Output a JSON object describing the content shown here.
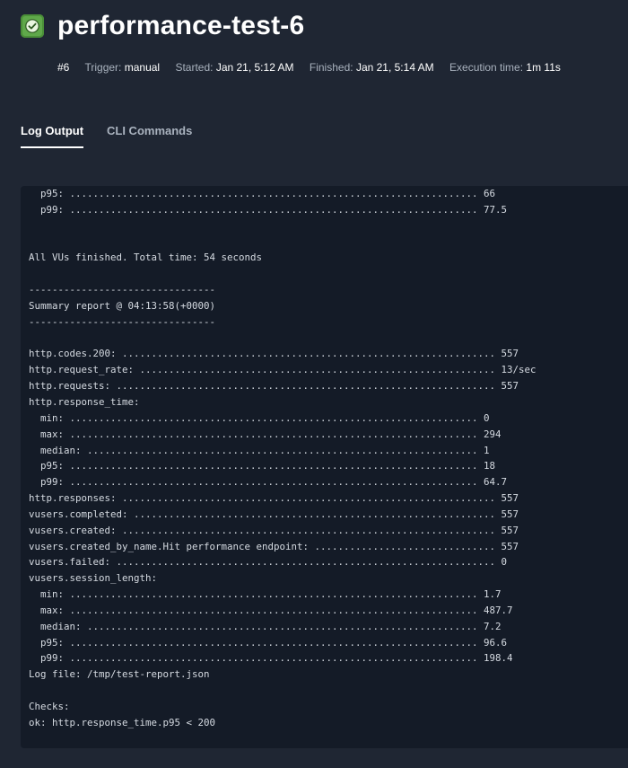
{
  "header": {
    "title": "performance-test-6",
    "status": "success",
    "status_color": "#5fa84a",
    "status_icon": "check-icon"
  },
  "meta": {
    "run_number": "#6",
    "trigger_label": "Trigger:",
    "trigger_value": "manual",
    "started_label": "Started:",
    "started_value": "Jan 21, 5:12 AM",
    "finished_label": "Finished:",
    "finished_value": "Jan 21, 5:14 AM",
    "execution_label": "Execution time:",
    "execution_value": "1m 11s"
  },
  "tabs": [
    {
      "label": "Log Output",
      "active": true
    },
    {
      "label": "CLI Commands",
      "active": false
    }
  ],
  "log": {
    "lines": [
      "  p95: ...................................................................... 66",
      "  p99: ...................................................................... 77.5",
      "",
      "",
      "All VUs finished. Total time: 54 seconds",
      "",
      "--------------------------------",
      "Summary report @ 04:13:58(+0000)",
      "--------------------------------",
      "",
      "http.codes.200: ................................................................ 557",
      "http.request_rate: ............................................................. 13/sec",
      "http.requests: ................................................................. 557",
      "http.response_time:",
      "  min: ...................................................................... 0",
      "  max: ...................................................................... 294",
      "  median: ................................................................... 1",
      "  p95: ...................................................................... 18",
      "  p99: ...................................................................... 64.7",
      "http.responses: ................................................................ 557",
      "vusers.completed: .............................................................. 557",
      "vusers.created: ................................................................ 557",
      "vusers.created_by_name.Hit performance endpoint: ............................... 557",
      "vusers.failed: ................................................................. 0",
      "vusers.session_length:",
      "  min: ...................................................................... 1.7",
      "  max: ...................................................................... 487.7",
      "  median: ................................................................... 7.2",
      "  p95: ...................................................................... 96.6",
      "  p99: ...................................................................... 198.4",
      "Log file: /tmp/test-report.json",
      "",
      "Checks:",
      "ok: http.response_time.p95 < 200"
    ]
  }
}
